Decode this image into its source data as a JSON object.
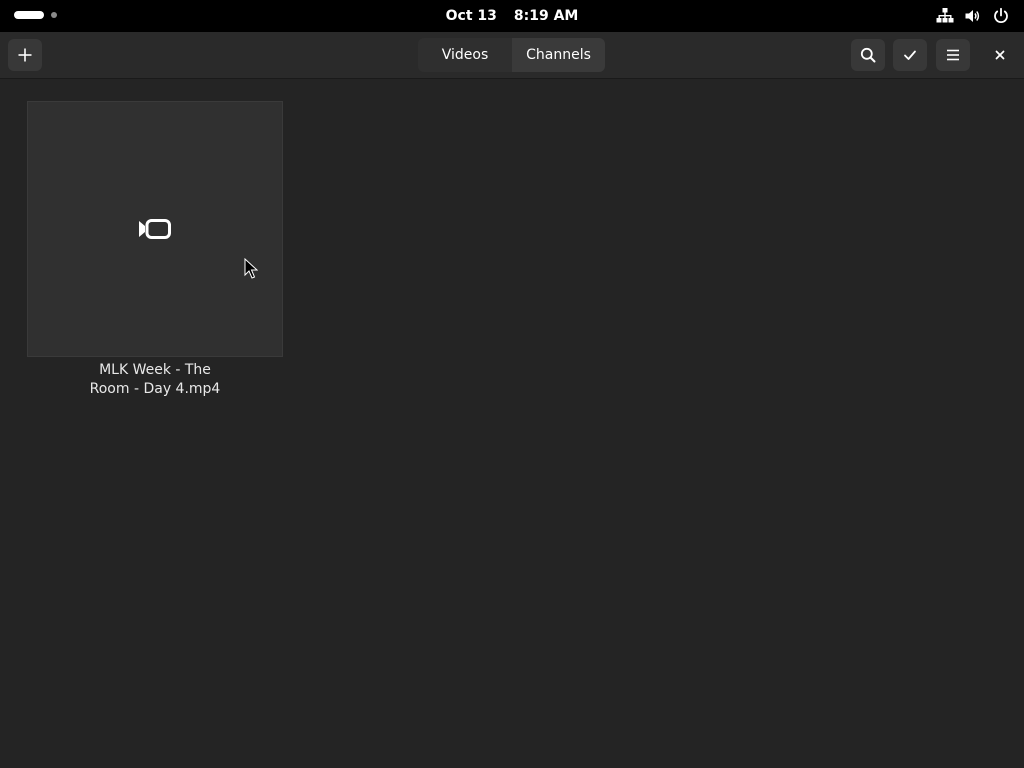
{
  "topbar": {
    "date": "Oct 13",
    "time": "8:19 AM",
    "icons": [
      "network-icon",
      "volume-icon",
      "power-icon"
    ]
  },
  "headerbar": {
    "tabs": [
      {
        "label": "Videos",
        "selected": false
      },
      {
        "label": "Channels",
        "selected": true
      }
    ],
    "buttons": [
      "add-icon",
      "search-icon",
      "checkmark-icon",
      "hamburger-menu-icon",
      "close-icon"
    ]
  },
  "videos": [
    {
      "title": "MLK Week - The Room - Day 4.mp4",
      "thumbnail_icon": "video-camera-icon"
    }
  ],
  "colors": {
    "background": "#242424",
    "headerbar": "#2a2a2a",
    "topbar": "#000000",
    "thumbnail": "#303030",
    "button": "#383838"
  }
}
